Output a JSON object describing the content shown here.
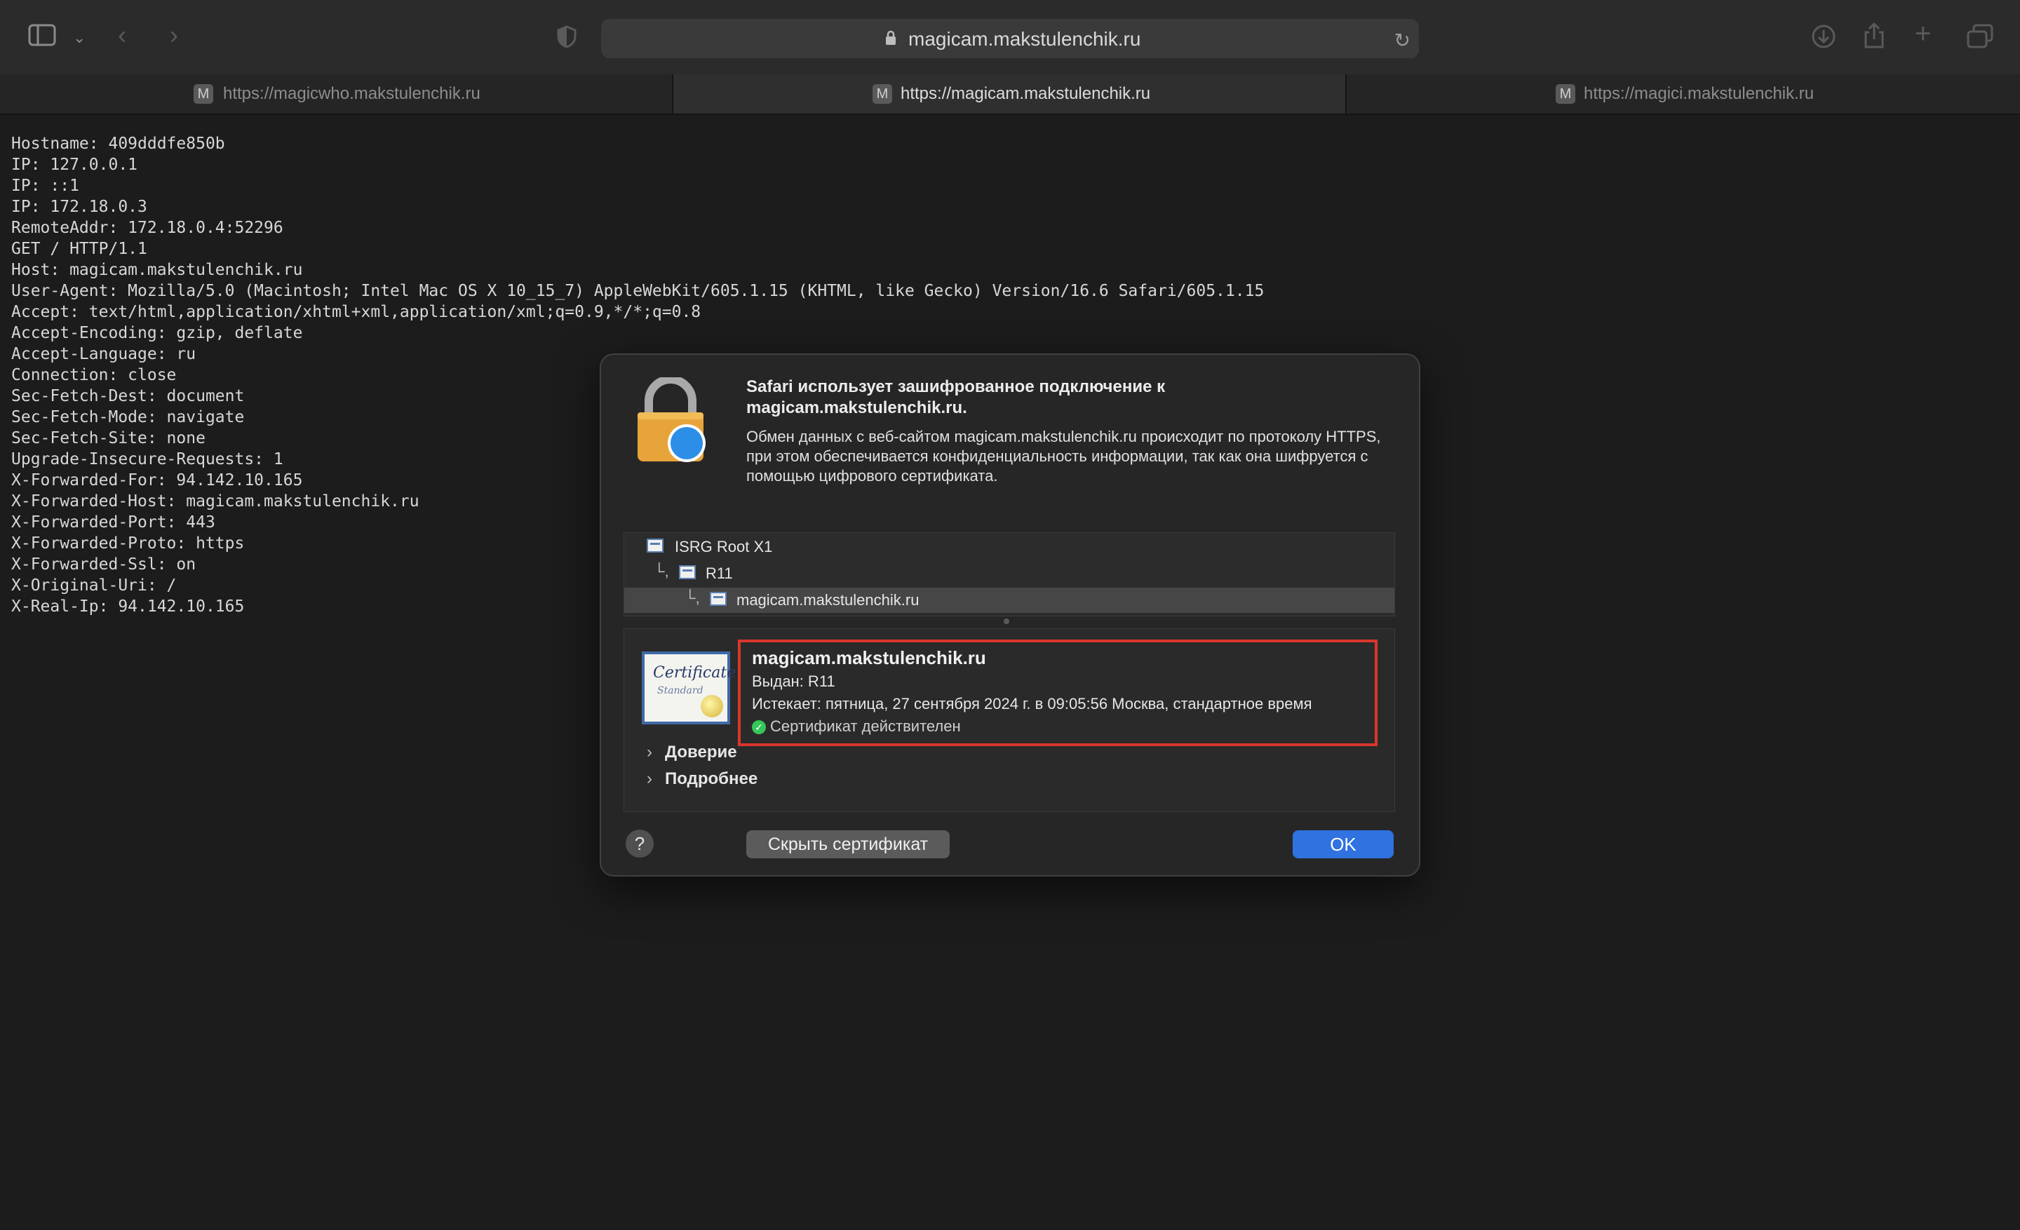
{
  "browser": {
    "address_url": "magicam.makstulenchik.ru",
    "tabs": [
      {
        "favicon": "M",
        "title": "https://magicwho.makstulenchik.ru"
      },
      {
        "favicon": "M",
        "title": "https://magicam.makstulenchik.ru"
      },
      {
        "favicon": "M",
        "title": "https://magici.makstulenchik.ru"
      }
    ]
  },
  "page": {
    "lines": [
      "Hostname: 409dddfe850b",
      "IP: 127.0.0.1",
      "IP: ::1",
      "IP: 172.18.0.3",
      "RemoteAddr: 172.18.0.4:52296",
      "GET / HTTP/1.1",
      "Host: magicam.makstulenchik.ru",
      "User-Agent: Mozilla/5.0 (Macintosh; Intel Mac OS X 10_15_7) AppleWebKit/605.1.15 (KHTML, like Gecko) Version/16.6 Safari/605.1.15",
      "Accept: text/html,application/xhtml+xml,application/xml;q=0.9,*/*;q=0.8",
      "Accept-Encoding: gzip, deflate",
      "Accept-Language: ru",
      "Connection: close",
      "Sec-Fetch-Dest: document",
      "Sec-Fetch-Mode: navigate",
      "Sec-Fetch-Site: none",
      "Upgrade-Insecure-Requests: 1",
      "X-Forwarded-For: 94.142.10.165",
      "X-Forwarded-Host: magicam.makstulenchik.ru",
      "X-Forwarded-Port: 443",
      "X-Forwarded-Proto: https",
      "X-Forwarded-Ssl: on",
      "X-Original-Uri: /",
      "X-Real-Ip: 94.142.10.165"
    ]
  },
  "dialog": {
    "title": "Safari использует зашифрованное подключение к magicam.makstulenchik.ru.",
    "body": "Обмен данных с веб-сайтом magicam.makstulenchik.ru происходит по протоколу HTTPS, при этом обеспечивается конфиденциальность информации, так как она шифруется с помощью цифрового сертификата.",
    "chain": [
      "ISRG Root X1",
      "R11",
      "magicam.makstulenchik.ru"
    ],
    "chain_arrow": "└,",
    "certificate": {
      "name": "magicam.makstulenchik.ru",
      "issued_by": "Выдан: R11",
      "expires": "Истекает: пятница, 27 сентября 2024 г. в 09:05:56 Москва, стандартное время",
      "status": "Сертификат действителен",
      "image_text": "Certificate",
      "image_subtext": "Standard"
    },
    "sections": [
      "Доверие",
      "Подробнее"
    ],
    "help_label": "?",
    "hide_button": "Скрыть сертификат",
    "ok_button": "OK"
  }
}
